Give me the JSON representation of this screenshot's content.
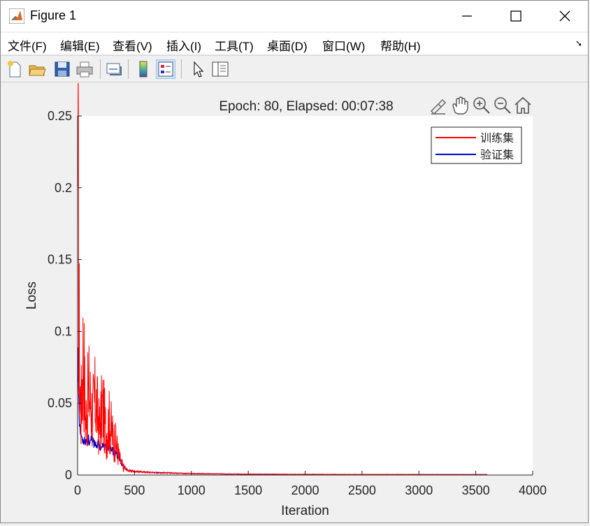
{
  "window": {
    "title": "Figure 1"
  },
  "menu": {
    "items": [
      {
        "name": "menu-file",
        "label": "文件(F)"
      },
      {
        "name": "menu-edit",
        "label": "编辑(E)"
      },
      {
        "name": "menu-view",
        "label": "查看(V)"
      },
      {
        "name": "menu-insert",
        "label": "插入(I)"
      },
      {
        "name": "menu-tools",
        "label": "工具(T)"
      },
      {
        "name": "menu-desktop",
        "label": "桌面(D)"
      },
      {
        "name": "menu-window",
        "label": "窗口(W)"
      },
      {
        "name": "menu-help",
        "label": "帮助(H)"
      }
    ]
  },
  "toolbar": {
    "buttons": [
      "new-figure-icon",
      "open-file-icon",
      "save-icon",
      "print-icon",
      "link-plot-icon",
      "insert-colorbar-icon",
      "insert-legend-icon",
      "edit-plot-icon",
      "property-inspector-icon"
    ]
  },
  "axes_toolbar": [
    "brush-icon",
    "pan-icon",
    "zoom-in-icon",
    "zoom-out-icon",
    "home-icon"
  ],
  "chart_data": {
    "type": "line",
    "title": "Epoch: 80, Elapsed: 00:07:38",
    "xlabel": "Iteration",
    "ylabel": "Loss",
    "xlim": [
      0,
      4000
    ],
    "ylim": [
      0,
      0.25
    ],
    "xticks": [
      "0",
      "500",
      "1000",
      "1500",
      "2000",
      "2500",
      "3000",
      "3500",
      "4000"
    ],
    "yticks": [
      "0",
      "0.05",
      "0.1",
      "0.15",
      "0.2",
      "0.25"
    ],
    "grid": false,
    "legend_position": "top-right",
    "series": [
      {
        "name": "训练集",
        "color": "#ff0000",
        "x": [
          0,
          5,
          10,
          20,
          30,
          50,
          70,
          100,
          130,
          160,
          190,
          220,
          250,
          280,
          310,
          340,
          370,
          400,
          450,
          500,
          600,
          700,
          800,
          1000,
          1200,
          1500,
          2000,
          2500,
          3000,
          3500,
          3600
        ],
        "y": [
          0.222,
          0.18,
          0.12,
          0.06,
          0.04,
          0.085,
          0.035,
          0.055,
          0.04,
          0.05,
          0.03,
          0.045,
          0.028,
          0.035,
          0.025,
          0.02,
          0.01,
          0.005,
          0.003,
          0.0025,
          0.002,
          0.0015,
          0.0015,
          0.001,
          0.0008,
          0.0006,
          0.0005,
          0.0004,
          0.0004,
          0.0003,
          0.0003
        ]
      },
      {
        "name": "验证集",
        "color": "#0000cc",
        "x": [
          0,
          5,
          10,
          20,
          40,
          70,
          100,
          150,
          200,
          250,
          300,
          350,
          400,
          450,
          500,
          600,
          800,
          1000,
          1500,
          2000,
          2500,
          3000,
          3600
        ],
        "y": [
          0.065,
          0.1,
          0.05,
          0.03,
          0.025,
          0.024,
          0.024,
          0.022,
          0.02,
          0.019,
          0.017,
          0.013,
          0.006,
          0.003,
          0.0025,
          0.002,
          0.0015,
          0.001,
          0.0006,
          0.0004,
          0.0003,
          0.0003,
          0.0003
        ]
      }
    ]
  }
}
